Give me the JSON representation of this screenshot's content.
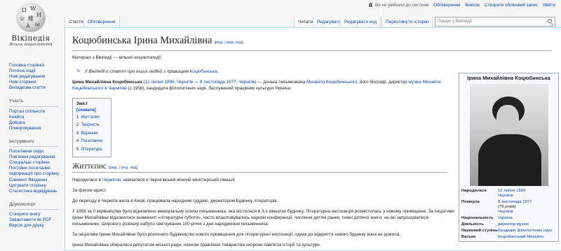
{
  "personal": {
    "notlogged": "Ви не увійшли до системи",
    "talk": "Обговорення",
    "contribs": "Внесок",
    "create": "Створити обліковий запис",
    "login": "Увійти"
  },
  "logo": {
    "wordmark": "Вікіпедія",
    "tagline": "Вільна енциклопедія"
  },
  "tabs": {
    "article": "Стаття",
    "talk": "Обговорення",
    "read": "Читати",
    "edit": "Редагувати",
    "editsource": "Редагувати код",
    "history": "Переглянути історію"
  },
  "search": {
    "placeholder": "Пошук у Вікіпедії"
  },
  "sidebar": {
    "nav": [
      "Головна сторінка",
      "Поточні події",
      "Нові редагування",
      "Нові сторінки",
      "Випадкова стаття"
    ],
    "participation": {
      "h": "Участь",
      "items": [
        "Портал спільноти",
        "Кнайпа",
        "Довідка",
        "Пожертвування"
      ]
    },
    "tools": {
      "h": "Інструменти",
      "items": [
        "Посилання сюди",
        "Пов'язані редагування",
        "Спеціальні сторінки",
        "Постійне посилання",
        "Інформація про сторінку",
        "Елемент Вікіданих",
        "Цитувати сторінку",
        "Статистика відвідувань"
      ]
    },
    "print": {
      "h": "Друк/експорт",
      "items": [
        "Створити книгу",
        "Завантажити як PDF",
        "Версія для друку"
      ]
    }
  },
  "article": {
    "title": "Коцюбинська Ірина Михайлівна",
    "edit_open": "[",
    "edit_link": "ред.",
    "edit_sep": " | ",
    "editcode_link": "ред. код",
    "edit_close": "]",
    "from": "Матеріал з Вікіпедії — вільної енциклопедії.",
    "hatnote": {
      "text": "У Вікіпедії є статті про інших людей з прізвищем ",
      "link": "Коцюбинська",
      "end": "."
    },
    "lead": {
      "name": "Ірина Михайлівна Коцюбинська",
      "t1": " (",
      "date1": "12 липня 1899",
      "c1": ", ",
      "place1": "Чернігів",
      "dash": " — ",
      "date2": "8 листопада 1977",
      "c2": ", ",
      "place2": "Чернігів",
      "t2": ") — донька письменника ",
      "father": "Михайла Коцюбинського",
      "t3": ", його біограф, директор ",
      "museum": "музею Михайла Коцюбинського в Чернігові",
      "t4": " (з 1956), кандидата філологічних наук, Заслужений працівник культури України."
    },
    "toc": {
      "title": "Зміст",
      "hide": "[сховати]",
      "items": [
        {
          "n": "1",
          "t": "Життєпис"
        },
        {
          "n": "2",
          "t": "Творчість"
        },
        {
          "n": "3",
          "t": "Відзнаки"
        },
        {
          "n": "4",
          "t": "Посилання"
        },
        {
          "n": "5",
          "t": "Література"
        }
      ]
    },
    "section": "Життєпис",
    "p1": {
      "a": "Народилася в ",
      "link": "Чернігові",
      "b": ", навчалася в Чернігівській жіночій міністерській гімназії."
    },
    "p2": "За фахом юрист.",
    "p3": "До переїзду в Чернігів жила в Києві, працювала народним суддею, директором Будинку літераторів.",
    "p4": "У 1958 за її керівництва було відновлено меморіальну оселю письменника, яка містилася в 3-х кімнатах будинку. Літературна експозиція розмістилась у новому приміщенні. За ініціативи Ірини Михайлівни відновилися знамениті «літературні суботи», часто влаштовувались наукові конференції, численні дитячі ранки, тижні дитячої книги, на які запрошувалися письменники. Широкого розмаху набуло святкування 100-річчя з дня народження письменника.",
    "p5": "За ініціативи Ірини Михайлівни було розпочато будівництво нового приміщення для літературної експозиції, однак до відкриття нового будинку вона не дожила.",
    "p6": "Ірина Михайлівна обиралася депутатом міської ради, членом правління товариства охорони пам'яток історії та культури."
  },
  "infobox": {
    "name": "Ірина Михайлівна Коцюбинська",
    "rows": [
      {
        "k": "Народилася",
        "v": "12 липня 1899",
        "v2": "Чернігів",
        "link": true
      },
      {
        "k": "Померла",
        "v": "8 листопада 1977",
        "v2": "(78 років)",
        "v3": "Чернігів",
        "link": true
      },
      {
        "k": "Національність",
        "v": "Україна",
        "link": true
      },
      {
        "k": "Діяльність",
        "v": "директор музею",
        "link": true
      },
      {
        "k": "Науковий ступінь",
        "v": "Кандидат філологічних наук",
        "link": true
      },
      {
        "k": "Батько",
        "v": "Коцюбинський Михайло",
        "link": true
      }
    ]
  }
}
